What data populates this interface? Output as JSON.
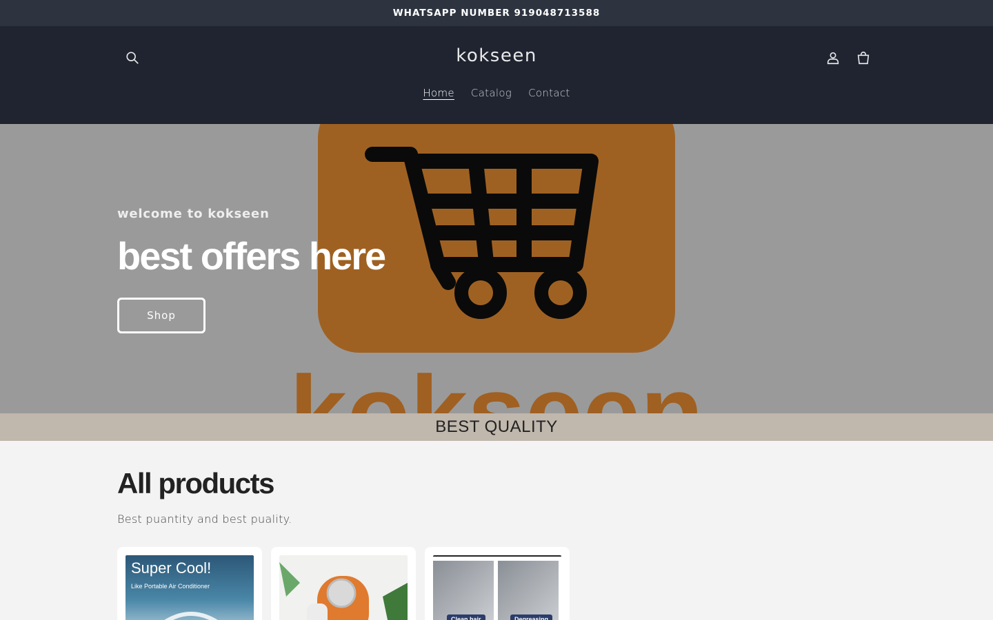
{
  "announcement": {
    "text": "WHATSAPP NUMBER 919048713588"
  },
  "header": {
    "logo": "kokseen",
    "nav": [
      {
        "label": "Home",
        "active": true
      },
      {
        "label": "Catalog",
        "active": false
      },
      {
        "label": "Contact",
        "active": false
      }
    ],
    "icons": [
      "search-icon",
      "account-icon",
      "cart-icon"
    ]
  },
  "hero": {
    "subtitle": "welcome to kokseen",
    "title": "best offers here",
    "button_label": "Shop",
    "logo_text": "kokseen",
    "colors": {
      "overlay": "#9a9a9a",
      "brand_orange": "#a05c18"
    }
  },
  "quality_bar": {
    "text": "BEST QUALITY"
  },
  "products": {
    "title": "All products",
    "subtitle": "Best puantity and best puality.",
    "items": [
      {
        "image_text_1": "Super Cool!",
        "image_text_2": "Like Portable Air Conditioner"
      },
      {
        "image_text_1": "",
        "image_text_2": ""
      },
      {
        "image_text_1": "Clean hair",
        "image_text_2": "Degreasing"
      }
    ]
  }
}
